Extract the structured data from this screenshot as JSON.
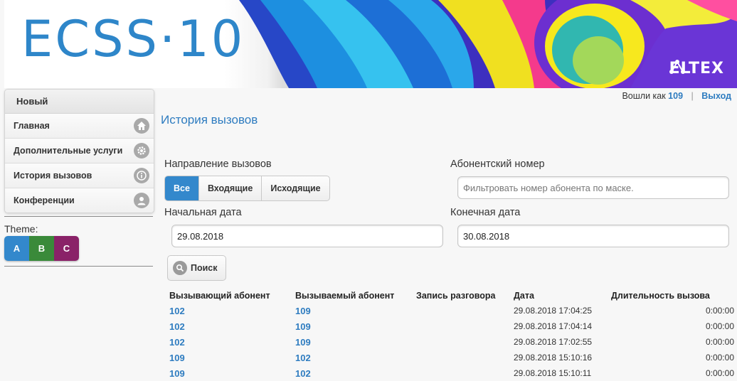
{
  "header": {
    "logo_text": "ECSS·10",
    "brand": "ELTEX",
    "login_prefix": "Вошли как",
    "user": "109",
    "logout_label": "Выход"
  },
  "sidebar": {
    "title": "Новый",
    "items": [
      {
        "label": "Главная",
        "icon": "home-icon"
      },
      {
        "label": "Дополнительные услуги",
        "icon": "gear-icon"
      },
      {
        "label": "История вызовов",
        "icon": "info-icon"
      },
      {
        "label": "Конференции",
        "icon": "user-icon"
      }
    ],
    "theme_label": "Theme:",
    "themes": [
      {
        "label": "A",
        "color": "#3388cc"
      },
      {
        "label": "B",
        "color": "#3a8a3a"
      },
      {
        "label": "C",
        "color": "#8a2268"
      }
    ]
  },
  "main": {
    "title": "История вызовов",
    "direction_label": "Направление вызовов",
    "direction_options": [
      "Все",
      "Входящие",
      "Исходящие"
    ],
    "direction_selected": "Все",
    "subscriber_label": "Абонентский номер",
    "subscriber_placeholder": "Фильтровать номер абонента по маске.",
    "start_date_label": "Начальная дата",
    "start_date_value": "29.08.2018",
    "end_date_label": "Конечная дата",
    "end_date_value": "30.08.2018",
    "search_label": "Поиск"
  },
  "table": {
    "columns": [
      "Вызывающий абонент",
      "Вызываемый абонент",
      "Запись разговора",
      "Дата",
      "Длительность вызова"
    ],
    "rows": [
      {
        "caller": "102",
        "callee": "109",
        "record": "",
        "date": "29.08.2018 17:04:25",
        "duration": "0:00:00"
      },
      {
        "caller": "102",
        "callee": "109",
        "record": "",
        "date": "29.08.2018 17:04:14",
        "duration": "0:00:00"
      },
      {
        "caller": "102",
        "callee": "109",
        "record": "",
        "date": "29.08.2018 17:02:55",
        "duration": "0:00:00"
      },
      {
        "caller": "109",
        "callee": "102",
        "record": "",
        "date": "29.08.2018 15:10:16",
        "duration": "0:00:00"
      },
      {
        "caller": "109",
        "callee": "102",
        "record": "",
        "date": "29.08.2018 15:10:11",
        "duration": "0:00:00"
      }
    ]
  }
}
